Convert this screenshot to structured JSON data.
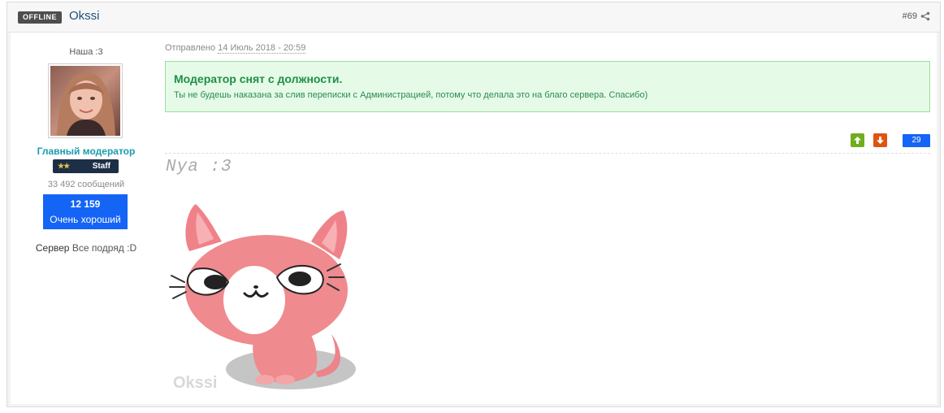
{
  "header": {
    "status_badge": "OFFLINE",
    "username": "Okssi",
    "post_number": "#69",
    "share_icon": "share-icon"
  },
  "author": {
    "user_title": "Наша :3",
    "group_name": "Главный модератор",
    "staff_badge": {
      "stars": "★★",
      "label": "Staff"
    },
    "post_count": "33 492 сообщений",
    "reputation": {
      "value": "12 159",
      "label": "Очень хороший"
    },
    "server_field": {
      "label": "Сервер",
      "value": "Все подряд :D"
    },
    "colors": {
      "group": "#1a9cb0",
      "reputation_bg": "#1464f6",
      "badge_bg": "#1d2f47"
    }
  },
  "post": {
    "posted_label": "Отправлено",
    "posted_date": "14 Июль 2018 - 20:59",
    "moderation_notice": {
      "title": "Модератор снят с должности.",
      "text": "Ты не будешь наказана за слив переписки с Администрацией, потому что делала это на благо сервера. Спасибо)"
    },
    "votes": {
      "up_icon": "thumb-up-icon",
      "down_icon": "thumb-down-icon",
      "count": "29"
    },
    "signature": {
      "text": "Nya :3",
      "image_watermark": "Okssi"
    },
    "colors": {
      "notice_bg": "#e6fbe7",
      "notice_text": "#1d8f47",
      "vote_up": "#6fae1f",
      "vote_down": "#e05412"
    }
  }
}
